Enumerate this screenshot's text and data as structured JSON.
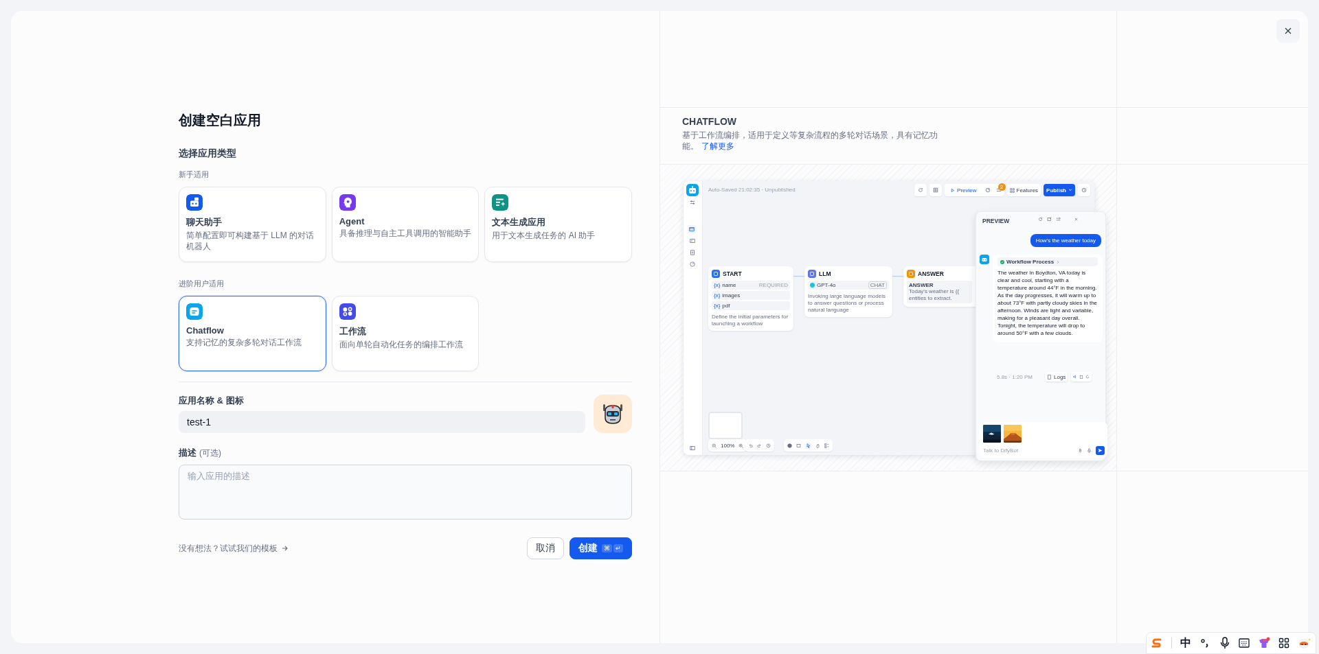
{
  "dialog": {
    "title": "创建空白应用",
    "section_label": "选择应用类型",
    "groups": [
      {
        "label": "新手适用",
        "types": [
          {
            "kind": "chatbot",
            "name": "聊天助手",
            "description": "简单配置即可构建基于 LLM 的对话机器人",
            "selected": false
          },
          {
            "kind": "agent",
            "name": "Agent",
            "description": "具备推理与自主工具调用的智能助手",
            "selected": false
          },
          {
            "kind": "completion",
            "name": "文本生成应用",
            "description": "用于文本生成任务的 AI 助手",
            "selected": false
          }
        ]
      },
      {
        "label": "进阶用户适用",
        "types": [
          {
            "kind": "chatflow",
            "name": "Chatflow",
            "description": "支持记忆的复杂多轮对话工作流",
            "selected": true
          },
          {
            "kind": "workflow",
            "name": "工作流",
            "description": "面向单轮自动化任务的编排工作流",
            "selected": false
          }
        ]
      }
    ],
    "name_field": {
      "label": "应用名称 & 图标",
      "value": "test-1"
    },
    "description_field": {
      "label": "描述",
      "optional": "(可选)",
      "placeholder": "输入应用的描述"
    },
    "template_link": "没有想法？试试我们的模板",
    "buttons": {
      "cancel": "取消",
      "create": "创建",
      "shortcut": [
        "⌘",
        "↵"
      ]
    }
  },
  "info": {
    "title": "CHATFLOW",
    "description": "基于工作流编排，适用于定义等复杂流程的多轮对话场景，具有记忆功能。",
    "link": "了解更多"
  },
  "preview_screenshot": {
    "status": "Auto-Saved 21:02:35 · Unpublished",
    "toolbar": {
      "preview": "Preview",
      "badge": "2",
      "features": "Features",
      "publish": "Publish"
    },
    "nodes": [
      {
        "kind": "start",
        "title": "START",
        "variables": [
          {
            "marker": "{x}",
            "name": "name",
            "tag": "REQUIRED"
          },
          {
            "marker": "{x}",
            "name": "images"
          },
          {
            "marker": "{x}",
            "name": "pdf"
          }
        ],
        "description": "Define the initial parameters for launching a workflow"
      },
      {
        "kind": "llm",
        "title": "LLM",
        "model": "GPT-4o",
        "mode": "CHAT",
        "description": "Invoking large language models to answer questions or process natural language"
      },
      {
        "kind": "answer",
        "title": "ANSWER",
        "label": "ANSWER",
        "lines": [
          "Today's weather is {{",
          "entities to extract."
        ]
      }
    ],
    "zoom": "100%",
    "chat": {
      "title": "PREVIEW",
      "user_message": "How's the weather today",
      "process": "Workflow Process",
      "reply": "The weather in Boydton, VA today is clear and cool, starting with a temperature around 44°F in the morning. As the day progresses, it will warm up to about 73°F with partly cloudy skies in the afternoon. Winds are light and variable, making for a pleasant day overall. Tonight, the temperature will drop to around 50°F with a few clouds.",
      "meta": "5.8s · 1:20 PM",
      "logs": "Logs",
      "placeholder": "Talk to DifyBot"
    }
  },
  "ime": {
    "mode": "中"
  }
}
